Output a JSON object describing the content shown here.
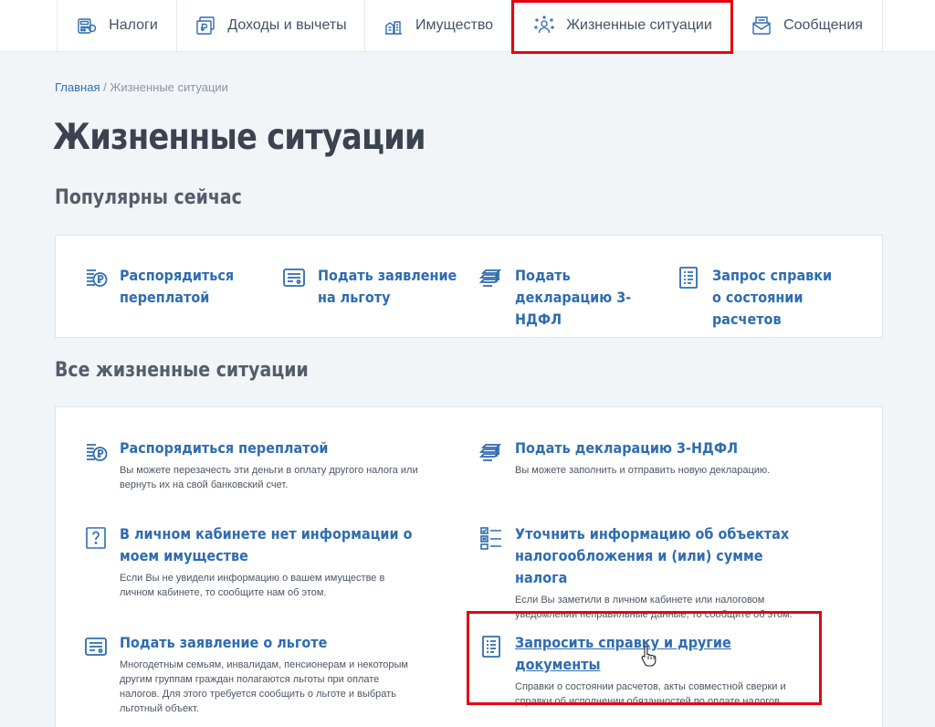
{
  "nav": {
    "tabs": [
      {
        "label": "Налоги",
        "icon": "tax-calculator-icon"
      },
      {
        "label": "Доходы и вычеты",
        "icon": "ruble-document-icon"
      },
      {
        "label": "Имущество",
        "icon": "property-icon"
      },
      {
        "label": "Жизненные ситуации",
        "icon": "life-situations-icon"
      },
      {
        "label": "Сообщения",
        "icon": "messages-icon"
      }
    ]
  },
  "breadcrumb": {
    "home": "Главная",
    "separator": " / ",
    "current": "Жизненные ситуации"
  },
  "page_title": "Жизненные ситуации",
  "popular": {
    "title": "Популярны сейчас",
    "items": [
      {
        "title": "Распорядиться переплатой",
        "icon": "ruble-coin-icon"
      },
      {
        "title": "Подать заявление на льготу",
        "icon": "application-form-icon"
      },
      {
        "title": "Подать декларацию 3-НДФЛ",
        "icon": "declaration-stack-icon"
      },
      {
        "title": "Запрос справки о состоянии расчетов",
        "icon": "document-list-icon"
      }
    ]
  },
  "all": {
    "title": "Все жизненные ситуации",
    "items": [
      {
        "title": "Распорядиться переплатой",
        "desc": "Вы можете перезачесть эти деньги в оплату другого налога или вернуть их на свой банковский счет.",
        "icon": "ruble-coin-icon"
      },
      {
        "title": "Подать декларацию 3-НДФЛ",
        "desc": "Вы можете заполнить и отправить новую декларацию.",
        "icon": "declaration-stack-icon"
      },
      {
        "title": "В личном кабинете нет информации о моем имуществе",
        "desc": "Если Вы не увидели информацию о вашем имуществе в личном кабинете, то сообщите нам об этом.",
        "icon": "question-document-icon"
      },
      {
        "title": "Уточнить информацию об объектах налогообложения и (или) сумме налога",
        "desc": "Если Вы заметили в личном кабинете или налоговом уведомлении неправильные данные, то сообщите об этом.",
        "icon": "checklist-icon"
      },
      {
        "title": "Подать заявление о льготе",
        "desc": "Многодетным семьям, инвалидам, пенсионерам и некоторым другим группам граждан полагаются льготы при оплате налогов. Для этого требуется сообщить о льготе и выбрать льготный объект.",
        "icon": "application-form-icon"
      },
      {
        "title": "Запросить справку и другие документы",
        "desc": "Справки о состоянии расчетов, акты совместной сверки и справки об исполнении обязанностей по оплате налогов.",
        "icon": "document-list-icon"
      }
    ]
  },
  "colors": {
    "accent": "#2e6cb0",
    "highlight": "#e30613",
    "background": "#f1f5f8"
  }
}
